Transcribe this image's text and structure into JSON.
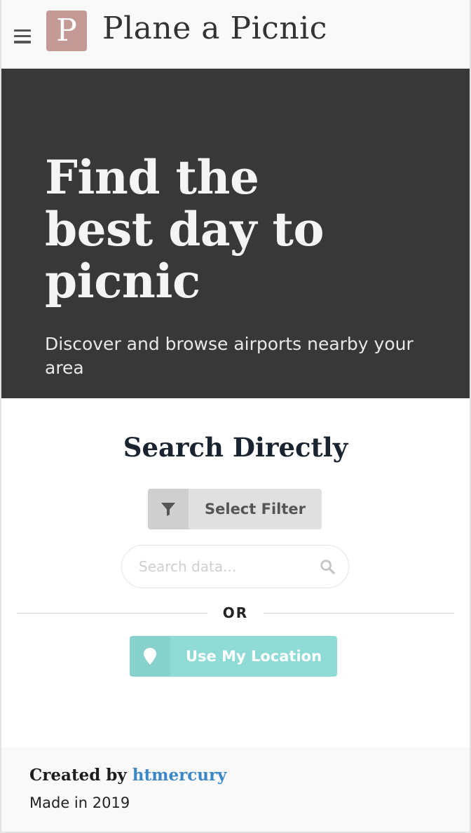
{
  "header": {
    "logo_letter": "P",
    "brand": "Plane a Picnic"
  },
  "hero": {
    "title": "Find the best day to picnic",
    "subtitle": "Discover and browse airports nearby your area"
  },
  "search": {
    "title": "Search Directly",
    "filter_label": "Select Filter",
    "input_placeholder": "Search data...",
    "input_value": "",
    "or_label": "OR",
    "location_label": "Use My Location"
  },
  "footer": {
    "created_prefix": "Created by",
    "author": "htmercury",
    "made": "Made in 2019"
  },
  "colors": {
    "logo_bg": "#c49a97",
    "hero_bg": "#383838",
    "location_button": "#8edbd6",
    "link": "#3a87c8"
  },
  "icons": {
    "menu": "hamburger-icon",
    "filter": "filter-icon",
    "search": "search-icon",
    "location": "map-pin-icon"
  }
}
